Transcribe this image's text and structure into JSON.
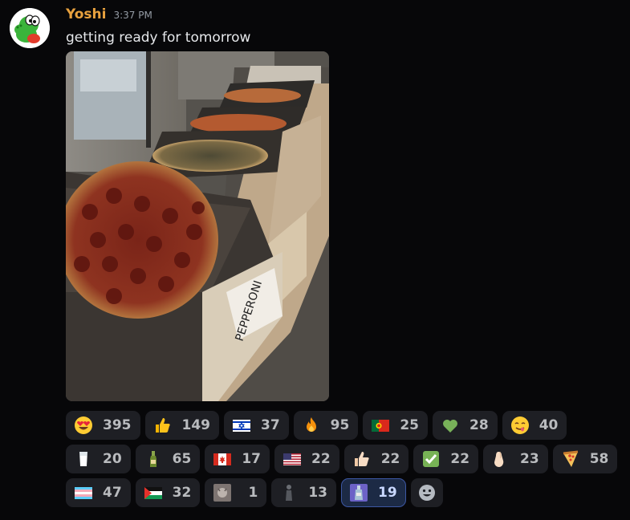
{
  "message": {
    "username": "Yoshi",
    "username_color": "#e8a13e",
    "timestamp": "3:37 PM",
    "text": "getting ready for tomorrow",
    "avatar_icon": "yoshi-avatar",
    "attachment": {
      "kind": "photo",
      "box_label": "PEPPERONI"
    }
  },
  "reactions": [
    {
      "emoji": "heart-eyes",
      "count": "395",
      "active": false
    },
    {
      "emoji": "thumbs-up",
      "count": "149",
      "active": false
    },
    {
      "emoji": "flag-israel",
      "count": "37",
      "active": false
    },
    {
      "emoji": "fire",
      "count": "95",
      "active": false
    },
    {
      "emoji": "flag-portugal",
      "count": "25",
      "active": false
    },
    {
      "emoji": "green-heart",
      "count": "28",
      "active": false
    },
    {
      "emoji": "yum",
      "count": "40",
      "active": false
    },
    {
      "emoji": "glass-of-milk",
      "count": "20",
      "active": false
    },
    {
      "emoji": "beer-bottle",
      "count": "65",
      "active": false
    },
    {
      "emoji": "flag-canada",
      "count": "17",
      "active": false
    },
    {
      "emoji": "flag-usa",
      "count": "22",
      "active": false
    },
    {
      "emoji": "thumbs-up-light",
      "count": "22",
      "active": false
    },
    {
      "emoji": "white-check-mark",
      "count": "22",
      "active": false
    },
    {
      "emoji": "pinched-fingers",
      "count": "23",
      "active": false
    },
    {
      "emoji": "pizza",
      "count": "58",
      "active": false
    },
    {
      "emoji": "flag-transgender",
      "count": "47",
      "active": false
    },
    {
      "emoji": "flag-palestine",
      "count": "32",
      "active": false
    },
    {
      "emoji": "custom-cat-photo",
      "count": "1",
      "active": false
    },
    {
      "emoji": "custom-figure",
      "count": "13",
      "active": false
    },
    {
      "emoji": "custom-bottle",
      "count": "19",
      "active": true
    }
  ],
  "add_reaction_icon": "add-reaction-smiley"
}
